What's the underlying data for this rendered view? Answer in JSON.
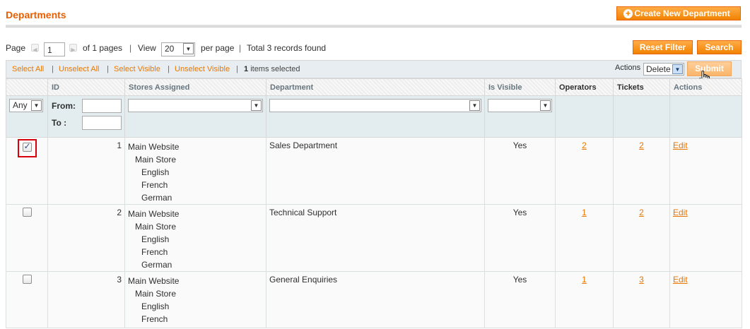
{
  "page_title": "Departments",
  "buttons": {
    "create": "Create New Department",
    "reset": "Reset Filter",
    "search": "Search",
    "submit": "Submit"
  },
  "pager": {
    "page_label": "Page",
    "page_value": "1",
    "of_pages": "of 1 pages",
    "sep": "|",
    "view_label": "View",
    "view_value": "20",
    "per_page": "per page",
    "total": "Total 3 records found"
  },
  "massaction": {
    "select_all": "Select All",
    "unselect_all": "Unselect All",
    "select_visible": "Select Visible",
    "unselect_visible": "Unselect Visible",
    "sep": "|",
    "items_count": "1",
    "items_selected": "items selected",
    "actions_label": "Actions",
    "action_value": "Delete"
  },
  "columns": [
    "",
    "ID",
    "Stores Assigned",
    "Department",
    "Is Visible",
    "Operators",
    "Tickets",
    "Actions"
  ],
  "filters": {
    "massaction_value": "Any",
    "from_label": "From:",
    "to_label": "To :"
  },
  "rows": [
    {
      "checked": true,
      "id": "1",
      "stores": [
        "Main Website",
        "Main Store",
        "English",
        "French",
        "German"
      ],
      "department": "Sales Department",
      "visible": "Yes",
      "operators": "2",
      "tickets": "2",
      "action": "Edit"
    },
    {
      "checked": false,
      "id": "2",
      "stores": [
        "Main Website",
        "Main Store",
        "English",
        "French",
        "German"
      ],
      "department": "Technical Support",
      "visible": "Yes",
      "operators": "1",
      "tickets": "2",
      "action": "Edit"
    },
    {
      "checked": false,
      "id": "3",
      "stores": [
        "Main Website",
        "Main Store",
        "English",
        "French"
      ],
      "department": "General Enquiries",
      "visible": "Yes",
      "operators": "1",
      "tickets": "3",
      "action": "Edit"
    }
  ],
  "colors": {
    "accent": "#eb5e00",
    "button": "#f18200",
    "link": "#ea7601",
    "highlight": "#d8000c"
  }
}
